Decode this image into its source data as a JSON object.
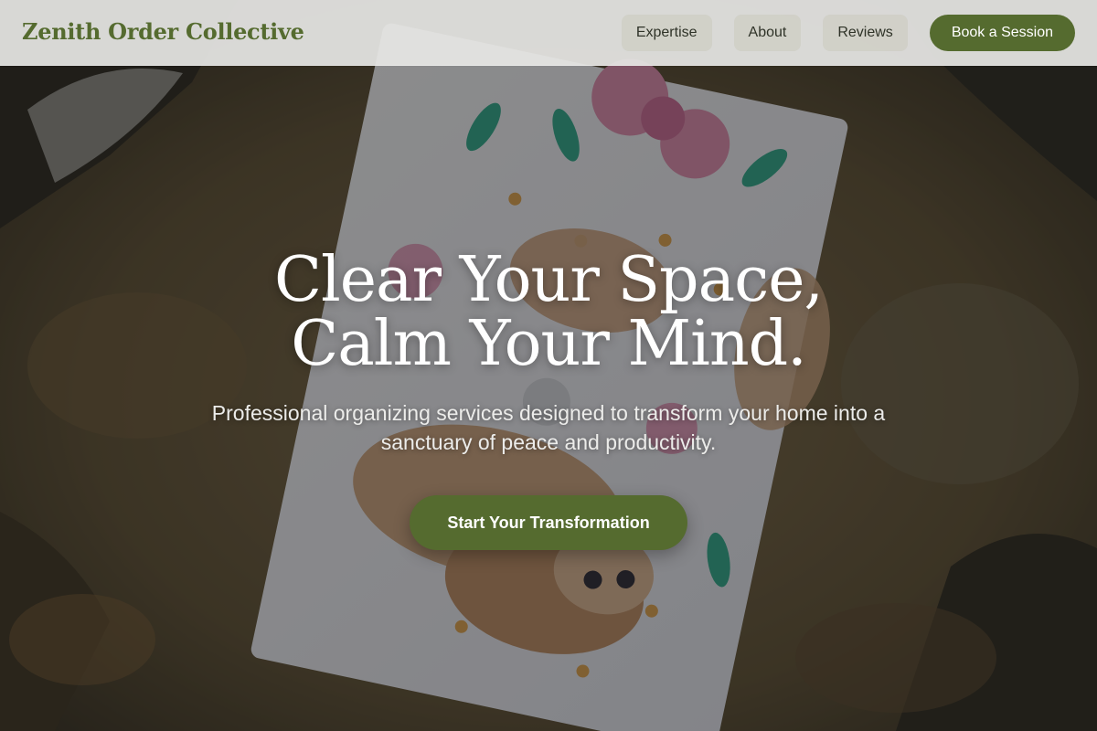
{
  "header": {
    "brand": "Zenith Order Collective",
    "nav": [
      {
        "label": "Expertise"
      },
      {
        "label": "About"
      },
      {
        "label": "Reviews"
      }
    ],
    "cta_label": "Book a Session"
  },
  "hero": {
    "title_line1": "Clear Your Space,",
    "title_line2": "Calm Your Mind.",
    "subtitle": "Professional organizing services designed to transform your home into a sanctuary of peace and productivity.",
    "cta_label": "Start Your Transformation",
    "background_image": "floral notebook with deer illustration resting on a rock"
  },
  "colors": {
    "accent": "#556b2f",
    "header_bg": "#e6e6e4",
    "nav_pill_bg": "#cdcdc3"
  }
}
